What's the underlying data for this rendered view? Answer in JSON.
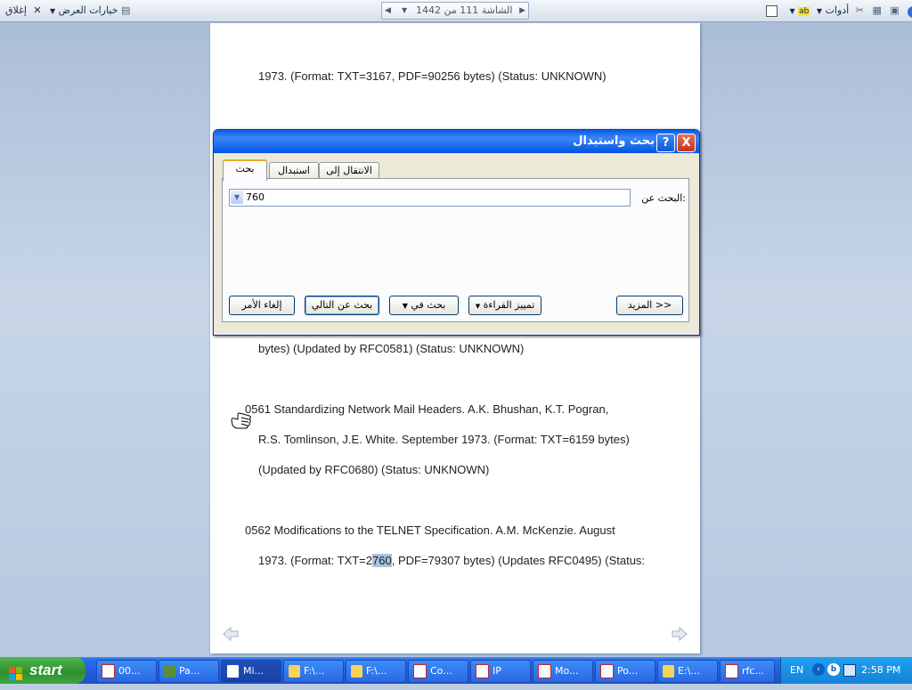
{
  "toolbar": {
    "close_label": "إغلاق",
    "view_options_label": "خيارات العرض",
    "screen_nav": "الشاشة 111 من 1442",
    "tools_label": "أدوات"
  },
  "document": {
    "lines": [
      "1973. (Format: TXT=3167, PDF=90256 bytes) (Status: UNKNOWN)",
      "bytes) (Updated by RFC0581) (Status: UNKNOWN)",
      "0561 Standardizing Network Mail Headers. A.K. Bhushan, K.T. Pogran,",
      "R.S. Tomlinson, J.E. White. September 1973. (Format: TXT=6159 bytes)",
      "(Updated by RFC0680) (Status: UNKNOWN)",
      "0562 Modifications to the TELNET Specification. A.M. McKenzie. August"
    ],
    "last_line_before": "1973. (Format: TXT=2",
    "last_line_highlight": "760",
    "last_line_after": ", PDF=79307 bytes) (Updates RFC0495) (Status:"
  },
  "dialog": {
    "title": "بحث واستبدال",
    "help": "?",
    "close": "X",
    "tabs": [
      "بحث",
      "استبدال",
      "الانتقال إلى"
    ],
    "find_label": "البحث عن:",
    "find_value": "760",
    "buttons": {
      "more": "المزيد >>",
      "reading_highlight": "تمييز القراءة",
      "find_in": "بحث في",
      "find_next": "بحث عن التالي",
      "cancel": "إلغاء الأمر"
    }
  },
  "taskbar": {
    "start": "start",
    "tasks": [
      "00...",
      "Pa...",
      "Mi...",
      "F:\\...",
      "F:\\...",
      "Co...",
      "IP",
      "Mo...",
      "Po...",
      "E:\\...",
      "rfc..."
    ],
    "language": "EN",
    "clock": "2:58 PM"
  },
  "colors": {
    "titlebar": "#0054e3",
    "taskbar": "#245edb",
    "start": "#3c9e3c",
    "highlight": "#a9c2df"
  }
}
